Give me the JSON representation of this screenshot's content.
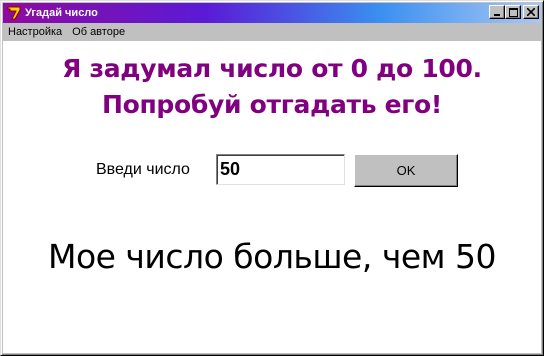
{
  "window": {
    "title": "Угадай число",
    "icon": "delphi-app-icon",
    "controls": [
      "minimize-icon",
      "maximize-icon",
      "close-icon"
    ]
  },
  "menu": {
    "items": [
      {
        "label": "Настройка"
      },
      {
        "label": "Об авторе"
      }
    ]
  },
  "main": {
    "headline_line1": "Я задумал число от 0 до 100.",
    "headline_line2": "Попробуй отгадать его!",
    "input_label": "Введи число",
    "input_value": "50",
    "ok_label": "OK",
    "result_text": "Мое число больше, чем 50"
  },
  "colors": {
    "headline": "#800080",
    "titlebar_start": "#8e0b9e",
    "titlebar_end": "#a8c8f4"
  }
}
